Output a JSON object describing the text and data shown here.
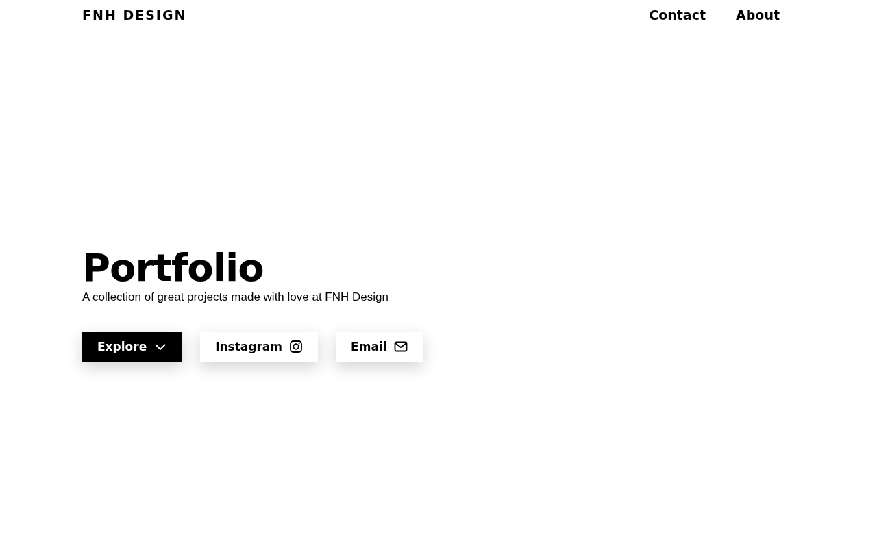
{
  "header": {
    "logo": "FNH DESIGN",
    "nav": [
      "Contact",
      "About"
    ]
  },
  "hero": {
    "title": "Portfolio",
    "subtitle": "A collection of great projects made with love at FNH Design",
    "buttons": [
      {
        "label": "Explore",
        "kind": "primary"
      },
      {
        "label": "Instagram",
        "kind": "secondary"
      },
      {
        "label": "Email",
        "kind": "secondary"
      }
    ]
  }
}
